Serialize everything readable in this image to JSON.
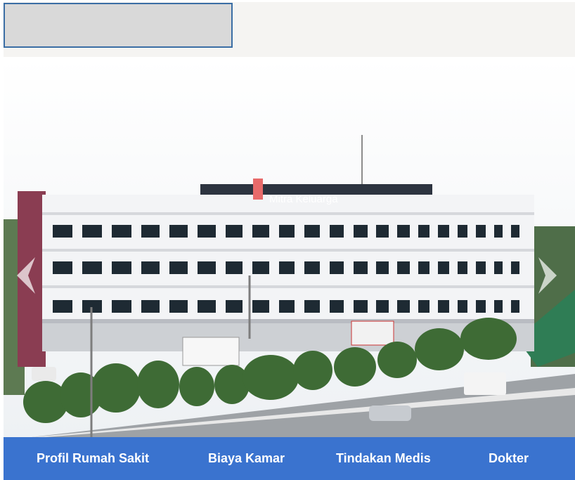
{
  "header": {
    "search_placeholder": ""
  },
  "hero": {
    "sign_text": "Mitra Keluarga",
    "prev_icon": "chevron-left-icon",
    "next_icon": "chevron-right-icon"
  },
  "nav": {
    "items": [
      {
        "label": "Profil Rumah Sakit"
      },
      {
        "label": "Biaya Kamar"
      },
      {
        "label": "Tindakan Medis"
      },
      {
        "label": "Dokter"
      }
    ]
  },
  "colors": {
    "nav_bg": "#3a73cf",
    "search_border": "#3b6ea5"
  }
}
